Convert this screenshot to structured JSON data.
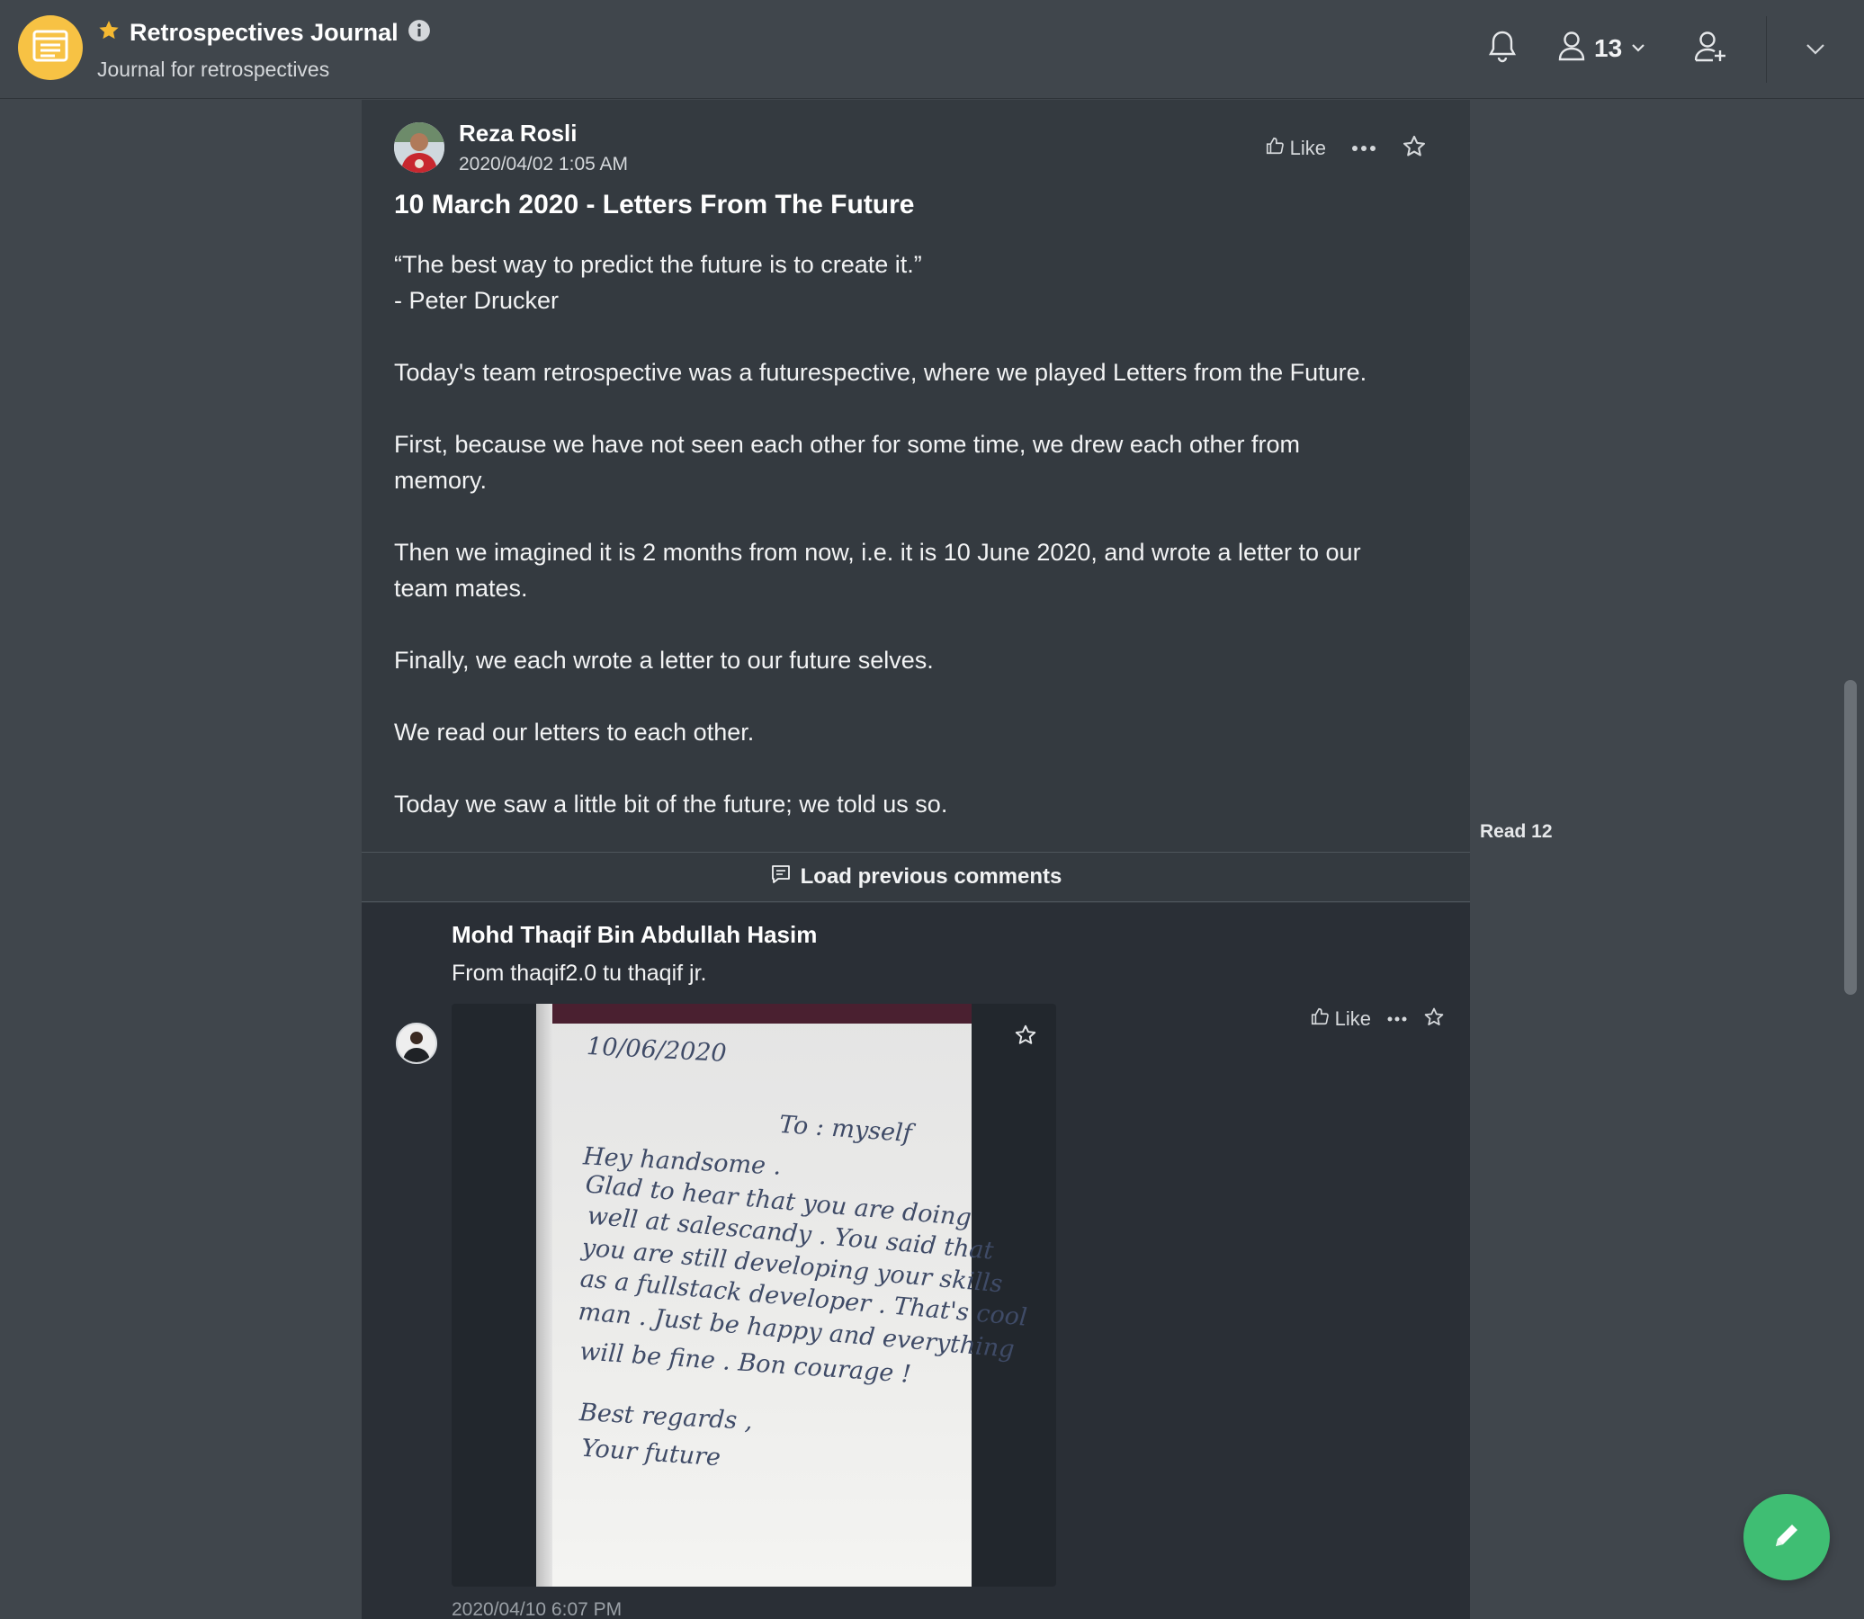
{
  "header": {
    "title": "Retrospectives Journal",
    "subtitle": "Journal for retrospectives",
    "member_count": "13",
    "icons": [
      "journal-icon",
      "star-icon",
      "info-icon",
      "bell-icon",
      "members-icon",
      "chevron-down-icon",
      "add-member-icon",
      "chevron-down-icon"
    ]
  },
  "post": {
    "author": "Reza Rosli",
    "timestamp": "2020/04/02 1:05 AM",
    "like_label": "Like",
    "title": "10 March 2020 - Letters From The Future",
    "paragraphs": [
      [
        "“The best way to predict the future is to create it.”",
        "- Peter Drucker"
      ],
      [
        "Today's team retrospective was a futurespective, where we played Letters from the Future."
      ],
      [
        "First, because  we have not seen each other for some time, we  drew each other from",
        "memory."
      ],
      [
        "Then  we  imagined it is 2 months from now, i.e. it is 10 June 2020, and wrote a letter to our",
        "team mates."
      ],
      [
        "Finally, we each wrote a letter to our future selves."
      ],
      [
        "We read our letters to each other."
      ],
      [
        "Today we saw a little bit of the future; we told us so."
      ]
    ]
  },
  "read_count": "Read 12",
  "load_previous_label": "Load previous comments",
  "comment": {
    "author": "Mohd Thaqif Bin Abdullah Hasim",
    "text": "From thaqif2.0 tu thaqif jr.",
    "like_label": "Like",
    "timestamp": "2020/04/10 6:07 PM",
    "attachment_handwriting": [
      "10/06/2020",
      "To : myself",
      "Hey handsome .",
      "Glad to hear that you are doing",
      "well at salescandy . You said that",
      "you are still developing your skills",
      "as a fullstack developer . That's cool",
      "man . Just be happy and everything",
      "will be fine . Bon courage !",
      "Best regards ,",
      "Your future"
    ]
  },
  "colors": {
    "header_bg": "#40464c",
    "post_bg": "#343a40",
    "comment_bg": "#2a2f36",
    "channel_avatar": "#f7c244",
    "star": "#f5b932",
    "fab": "#3fbe73"
  }
}
